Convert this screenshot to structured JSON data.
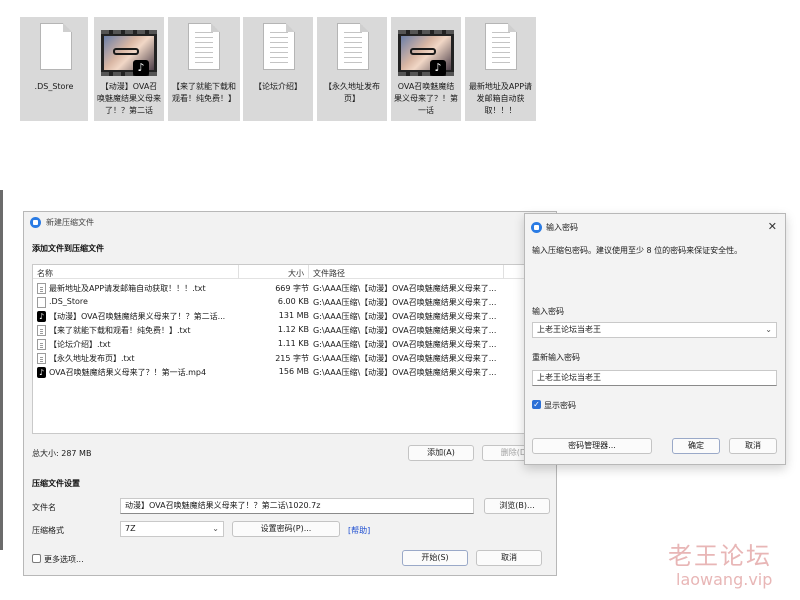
{
  "explorer": {
    "files": [
      {
        "name": ".DS_Store",
        "type": "blank"
      },
      {
        "name": "【动漫】OVA召唤魅魔结果义母来了！？第二话",
        "type": "video"
      },
      {
        "name": "【来了就能下载和观看！纯免费！】",
        "type": "txt"
      },
      {
        "name": "【论坛介绍】",
        "type": "txt"
      },
      {
        "name": "【永久地址发布页】",
        "type": "txt"
      },
      {
        "name": "OVA召唤魅魔结果义母来了？！第一话",
        "type": "video"
      },
      {
        "name": "最新地址及APP请发邮箱自动获取！！！",
        "type": "txt"
      }
    ]
  },
  "archive_dialog": {
    "title": "新建压缩文件",
    "add_section": "添加文件到压缩文件",
    "columns": {
      "name": "名称",
      "size": "大小",
      "path": "文件路径"
    },
    "rows": [
      {
        "icon": "txt",
        "name": "最新地址及APP请发邮箱自动获取！！！.txt",
        "size": "669 字节",
        "path": "G:\\AAA压缩\\【动漫】OVA召唤魅魔结果义母来了..."
      },
      {
        "icon": "blank",
        "name": ".DS_Store",
        "size": "6.00 KB",
        "path": "G:\\AAA压缩\\【动漫】OVA召唤魅魔结果义母来了..."
      },
      {
        "icon": "tiktok",
        "name": "【动漫】OVA召唤魅魔结果义母来了！？第二话...",
        "size": "131 MB",
        "path": "G:\\AAA压缩\\【动漫】OVA召唤魅魔结果义母来了..."
      },
      {
        "icon": "txt",
        "name": "【来了就能下载和观看！纯免费！】.txt",
        "size": "1.12 KB",
        "path": "G:\\AAA压缩\\【动漫】OVA召唤魅魔结果义母来了..."
      },
      {
        "icon": "txt",
        "name": "【论坛介绍】.txt",
        "size": "1.11 KB",
        "path": "G:\\AAA压缩\\【动漫】OVA召唤魅魔结果义母来了..."
      },
      {
        "icon": "txt",
        "name": "【永久地址发布页】.txt",
        "size": "215 字节",
        "path": "G:\\AAA压缩\\【动漫】OVA召唤魅魔结果义母来了..."
      },
      {
        "icon": "tiktok",
        "name": "OVA召唤魅魔结果义母来了？！第一话.mp4",
        "size": "156 MB",
        "path": "G:\\AAA压缩\\【动漫】OVA召唤魅魔结果义母来了..."
      }
    ],
    "total_size": "总大小: 287 MB",
    "add_button": "添加(A)",
    "delete_button": "删除(D)",
    "settings_section": "压缩文件设置",
    "filename_label": "文件名",
    "filename_value": "动漫】OVA召唤魅魔结果义母来了！？第二话\\1020.7z",
    "browse_button": "浏览(B)...",
    "format_label": "压缩格式",
    "format_value": "7Z",
    "set_password_button": "设置密码(P)...",
    "help_link": "[帮助]",
    "more_options": "更多选项...",
    "start_button": "开始(S)",
    "cancel_button": "取消"
  },
  "password_dialog": {
    "title": "输入密码",
    "hint": "输入压缩包密码。建议使用至少 8 位的密码来保证安全性。",
    "password_label": "输入密码",
    "password_value": "上老王论坛当老王",
    "confirm_label": "重新输入密码",
    "confirm_value": "上老王论坛当老王",
    "show_password": "显示密码",
    "manager_button": "密码管理器...",
    "ok_button": "确定",
    "cancel_button": "取消"
  },
  "watermark": {
    "text": "老王论坛",
    "url": "laowang.vip"
  }
}
